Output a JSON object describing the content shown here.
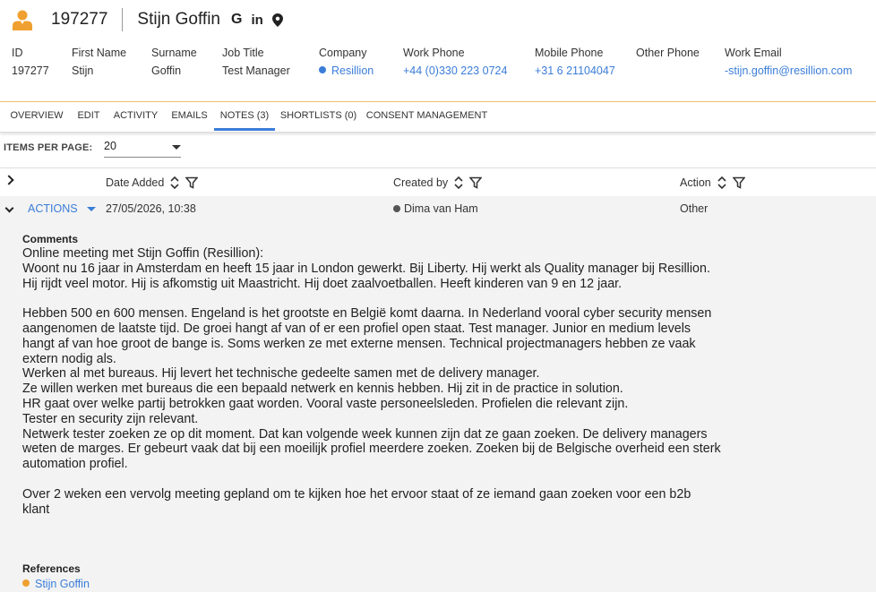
{
  "header": {
    "record_id": "197277",
    "record_name": "Stijn Goffin",
    "icons": [
      "person-icon",
      "google-icon",
      "linkedin-icon",
      "map-pin-icon"
    ],
    "accent_color": "#f0a030"
  },
  "fields": [
    {
      "label": "ID",
      "value": "197277",
      "link": false
    },
    {
      "label": "First Name",
      "value": "Stijn",
      "link": false
    },
    {
      "label": "Surname",
      "value": "Goffin",
      "link": false
    },
    {
      "label": "Job Title",
      "value": "Test Manager",
      "link": false
    },
    {
      "label": "Company",
      "value": "Resillion",
      "link": true,
      "dot_color": "#3b7dd8"
    },
    {
      "label": "Work Phone",
      "value": "+44 (0)330 223 0724",
      "link": true
    },
    {
      "label": "Mobile Phone",
      "value": "+31 6 21104047",
      "link": true
    },
    {
      "label": "Other Phone",
      "value": "",
      "link": false
    },
    {
      "label": "Work Email",
      "value": "-stijn.goffin@resillion.com",
      "link": true
    }
  ],
  "tabs": [
    {
      "label": "OVERVIEW",
      "active": false
    },
    {
      "label": "EDIT",
      "active": false
    },
    {
      "label": "ACTIVITY",
      "active": false
    },
    {
      "label": "EMAILS",
      "active": false
    },
    {
      "label": "NOTES (3)",
      "active": true
    },
    {
      "label": "SHORTLISTS (0)",
      "active": false
    },
    {
      "label": "CONSENT MANAGEMENT",
      "active": false
    }
  ],
  "items_per_page": {
    "label": "ITEMS PER PAGE:",
    "value": "20"
  },
  "grid": {
    "columns": [
      "Date Added",
      "Created by",
      "Action"
    ],
    "row": {
      "actions_label": "ACTIONS",
      "date_added": "27/05/2026, 10:38",
      "created_by": "Dima van Ham",
      "action": "Other"
    }
  },
  "note": {
    "comments_label": "Comments",
    "comments_text": "Online meeting met Stijn Goffin (Resillion):\nWoont nu 16 jaar in Amsterdam en heeft 15 jaar in London gewerkt. Bij Liberty. Hij werkt als Quality manager bij Resillion. Hij rijdt veel motor. Hij is afkomstig uit Maastricht. Hij doet zaalvoetballen. Heeft kinderen van 9 en 12 jaar.\n\nHebben 500 en 600 mensen. Engeland is het grootste en België komt daarna. In Nederland vooral cyber security mensen aangenomen de laatste tijd. De groei hangt af van of er een profiel open staat. Test manager. Junior en medium levels hangt af van hoe groot de bange is. Soms werken ze met externe mensen. Technical projectmanagers hebben ze vaak extern nodig als.\nWerken al met bureaus. Hij levert het technische gedeelte samen met de delivery manager.\nZe willen werken met bureaus die een bepaald netwerk en kennis hebben. Hij zit in de practice in solution.\nHR gaat over welke partij betrokken gaat worden. Vooral vaste personeelsleden. Profielen die relevant zijn.\nTester en security zijn relevant.\nNetwerk tester zoeken ze op dit moment. Dat kan volgende week kunnen zijn dat ze gaan zoeken. De delivery managers weten de marges. Er gebeurt vaak dat bij een moeilijk profiel meerdere zoeken. Zoeken bij de Belgische overheid een sterk automation profiel.\n\nOver 2 weken een vervolg meeting gepland om te kijken hoe het ervoor staat of ze iemand gaan zoeken voor een b2b klant",
    "references_label": "References",
    "references": [
      {
        "name": "Stijn Goffin",
        "dot_color": "#f0a030"
      }
    ]
  }
}
